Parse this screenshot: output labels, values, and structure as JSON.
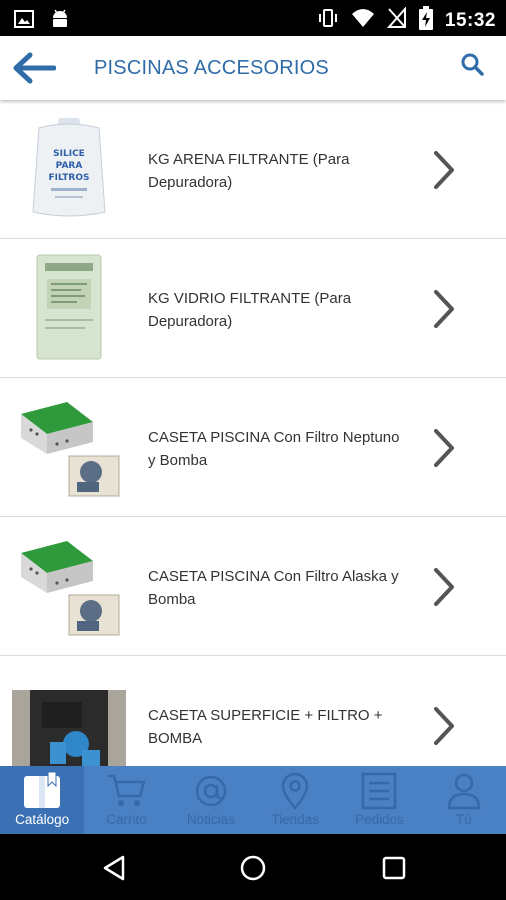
{
  "status_bar": {
    "time": "15:32",
    "icons": [
      "image-icon",
      "android-icon",
      "vibrate-icon",
      "wifi-icon",
      "no-signal-icon",
      "battery-charging-icon"
    ]
  },
  "app_bar": {
    "title": "PISCINAS ACCESORIOS",
    "back_icon": "arrow-left-icon",
    "search_icon": "search-icon"
  },
  "products": [
    {
      "title": "KG ARENA FILTRANTE (Para Depuradora)",
      "image_text": [
        "SILICE",
        "PARA",
        "FILTROS"
      ]
    },
    {
      "title": "KG VIDRIO FILTRANTE (Para Depuradora)",
      "image_text": []
    },
    {
      "title": "CASETA PISCINA Con Filtro Neptuno y Bomba",
      "image_text": []
    },
    {
      "title": "CASETA PISCINA Con Filtro Alaska y Bomba",
      "image_text": []
    },
    {
      "title": "CASETA SUPERFICIE + FILTRO + BOMBA",
      "image_text": []
    }
  ],
  "bottom_nav": {
    "active": "Catálogo",
    "items": [
      {
        "label": "Catálogo",
        "icon": "book-icon"
      },
      {
        "label": "Carrito",
        "icon": "cart-icon"
      },
      {
        "label": "Noticias",
        "icon": "at-icon"
      },
      {
        "label": "Tiendas",
        "icon": "map-pin-icon"
      },
      {
        "label": "Pedidos",
        "icon": "list-icon"
      },
      {
        "label": "Tú",
        "icon": "user-icon"
      }
    ]
  },
  "colors": {
    "accent": "#2f6ca8",
    "nav_bar": "#4a80c4",
    "nav_active": "#3b70b4",
    "nav_inactive_label": "#3669ab"
  }
}
